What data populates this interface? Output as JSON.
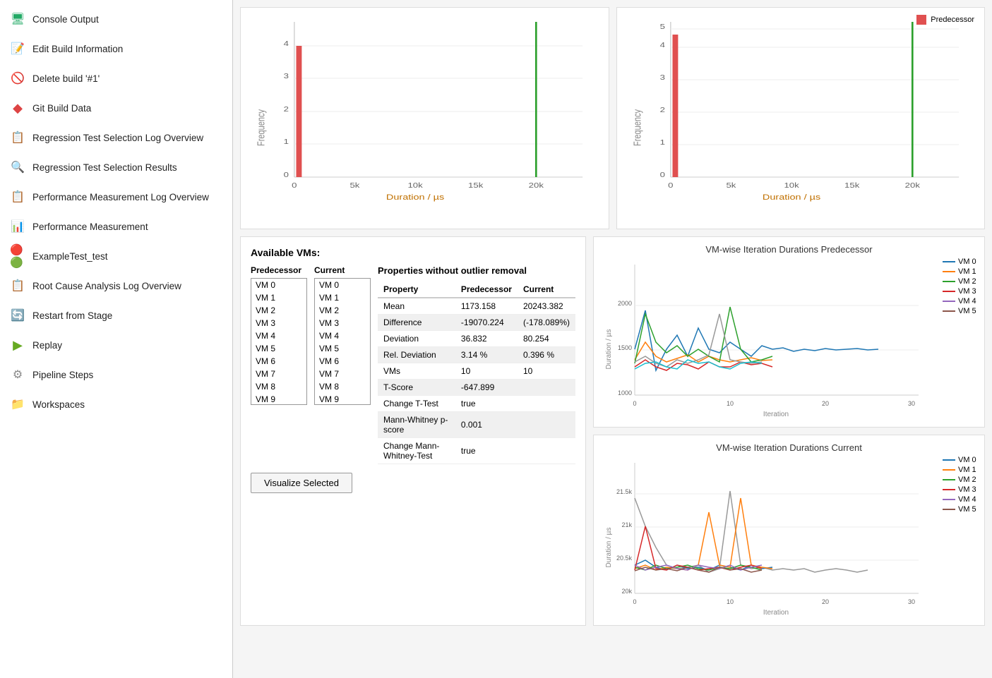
{
  "sidebar": {
    "items": [
      {
        "id": "console-output",
        "label": "Console Output",
        "icon": "🖥",
        "color": "#2a6"
      },
      {
        "id": "edit-build-info",
        "label": "Edit Build Information",
        "icon": "📝",
        "color": "#888"
      },
      {
        "id": "delete-build",
        "label": "Delete build '#1'",
        "icon": "🚫",
        "color": "#d00"
      },
      {
        "id": "git-build-data",
        "label": "Git Build Data",
        "icon": "◆",
        "color": "#d44"
      },
      {
        "id": "regression-log",
        "label": "Regression Test Selection Log Overview",
        "icon": "📋",
        "color": "#888"
      },
      {
        "id": "regression-results",
        "label": "Regression Test Selection Results",
        "icon": "🔍",
        "color": "#333"
      },
      {
        "id": "perf-log",
        "label": "Performance Measurement Log Overview",
        "icon": "📋",
        "color": "#888"
      },
      {
        "id": "perf-measure",
        "label": "Performance Measurement",
        "icon": "📊",
        "color": "#a00"
      },
      {
        "id": "example-test",
        "label": "ExampleTest_test",
        "icon": "⚙",
        "color": "#d04"
      },
      {
        "id": "root-cause",
        "label": "Root Cause Analysis Log Overview",
        "icon": "📋",
        "color": "#888"
      },
      {
        "id": "restart-stage",
        "label": "Restart from Stage",
        "icon": "🔄",
        "color": "#07a"
      },
      {
        "id": "replay",
        "label": "Replay",
        "icon": "▶",
        "color": "#6a2"
      },
      {
        "id": "pipeline-steps",
        "label": "Pipeline Steps",
        "icon": "⚙",
        "color": "#888"
      },
      {
        "id": "workspaces",
        "label": "Workspaces",
        "icon": "📁",
        "color": "#555"
      }
    ]
  },
  "available_vms": {
    "title": "Available VMs:",
    "predecessor_label": "Predecessor",
    "current_label": "Current",
    "vms": [
      "VM 0",
      "VM 1",
      "VM 2",
      "VM 3",
      "VM 4",
      "VM 5",
      "VM 6",
      "VM 7",
      "VM 8",
      "VM 9"
    ]
  },
  "properties_table": {
    "title": "Properties without outlier removal",
    "headers": [
      "Property",
      "Predecessor",
      "Current"
    ],
    "rows": [
      [
        "Mean",
        "1173.158",
        "20243.382"
      ],
      [
        "Difference",
        "-19070.224",
        "(-178.089%)"
      ],
      [
        "Deviation",
        "36.832",
        "80.254"
      ],
      [
        "Rel. Deviation",
        "3.14 %",
        "0.396 %"
      ],
      [
        "VMs",
        "10",
        "10"
      ],
      [
        "T-Score",
        "-647.899",
        ""
      ],
      [
        "Change T-Test",
        "true",
        ""
      ],
      [
        "Mann-Whitney p-score",
        "0.001",
        ""
      ],
      [
        "Change Mann-Whitney-Test",
        "true",
        ""
      ]
    ]
  },
  "visualize_btn": "Visualize Selected",
  "charts": {
    "vm_iteration_predecessor": {
      "title": "VM-wise Iteration Durations Predecessor",
      "x_label": "Iteration",
      "y_label": "Duration / µs",
      "y_min": 1000,
      "y_max": 2000,
      "y_ticks": [
        "2000",
        "1500",
        "1000"
      ]
    },
    "vm_iteration_current": {
      "title": "VM-wise Iteration Durations Current",
      "x_label": "Iteration",
      "y_label": "Duration / µs",
      "y_min": 20000,
      "y_max": 21500,
      "y_ticks": [
        "21.5k",
        "21k",
        "20.5k",
        "20k"
      ]
    }
  },
  "legend": {
    "items": [
      {
        "label": "VM 0",
        "color": "#1f77b4"
      },
      {
        "label": "VM 1",
        "color": "#ff7f0e"
      },
      {
        "label": "VM 2",
        "color": "#2ca02c"
      },
      {
        "label": "VM 3",
        "color": "#d62728"
      },
      {
        "label": "VM 4",
        "color": "#9467bd"
      },
      {
        "label": "VM 5",
        "color": "#8c564b"
      }
    ]
  },
  "histogram_predecessor_label": "Predecessor",
  "predecessor_color": "#e05050"
}
